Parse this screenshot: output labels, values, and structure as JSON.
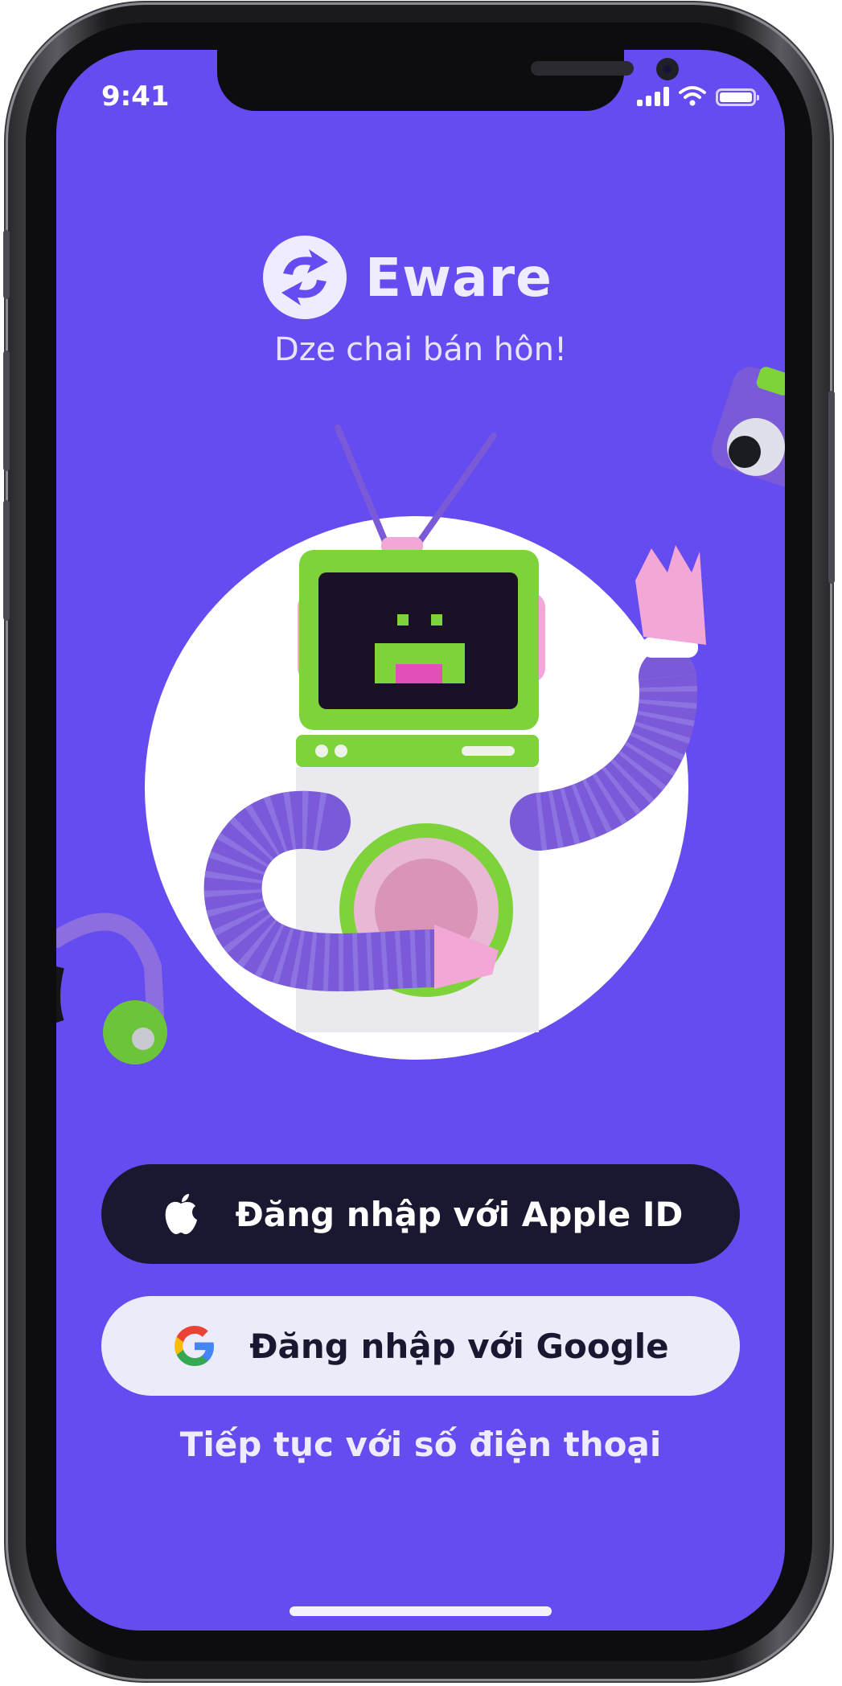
{
  "status_bar": {
    "time": "9:41"
  },
  "brand": {
    "name": "Eware",
    "tagline": "Dze chai bán hôn!"
  },
  "auth": {
    "apple_label": "Đăng nhập với Apple ID",
    "google_label": "Đăng nhập với Google",
    "phone_label": "Tiếp tục với số điện thoại"
  },
  "colors": {
    "background": "#644cf0",
    "apple_button": "#1a1830",
    "google_button": "#ecebfa",
    "robot_green": "#7ed33a",
    "robot_purple": "#7a5ad8",
    "robot_pink": "#f3a7d6"
  },
  "icons": {
    "logo": "eware-swap-logo",
    "apple": "apple-icon",
    "google": "google-icon"
  }
}
